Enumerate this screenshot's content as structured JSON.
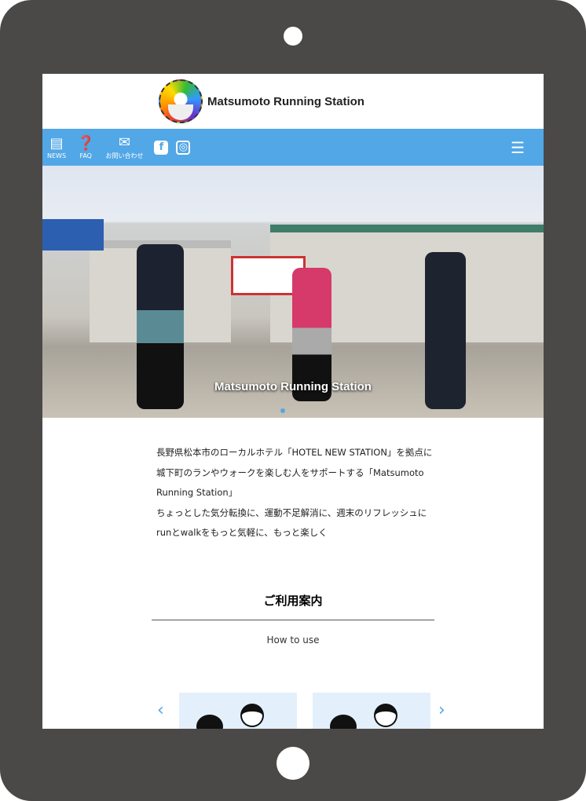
{
  "header": {
    "brand": "Matsumoto Running Station"
  },
  "nav": {
    "items": [
      {
        "label": "NEWS",
        "icon": "newspaper-icon"
      },
      {
        "label": "FAQ",
        "icon": "question-icon"
      },
      {
        "label": "お問い合わせ",
        "icon": "mail-icon"
      }
    ],
    "social": [
      "facebook-icon",
      "instagram-icon"
    ],
    "menu_icon": "hamburger-icon"
  },
  "hero": {
    "caption": "Matsumoto Running Station"
  },
  "intro": {
    "lines": [
      "長野県松本市のローカルホテル「HOTEL NEW STATION」を拠点に",
      "城下町のランやウォークを楽しむ人をサポートする「Matsumoto",
      "Running Station」",
      "ちょっとした気分転換に、運動不足解消に、週末のリフレッシュに",
      "runとwalkをもっと気軽に、もっと楽しく"
    ]
  },
  "how_to_use": {
    "title": "ご利用案内",
    "subtitle": "How to use"
  },
  "colors": {
    "accent": "#52a7e6",
    "frame": "#4b4947"
  }
}
